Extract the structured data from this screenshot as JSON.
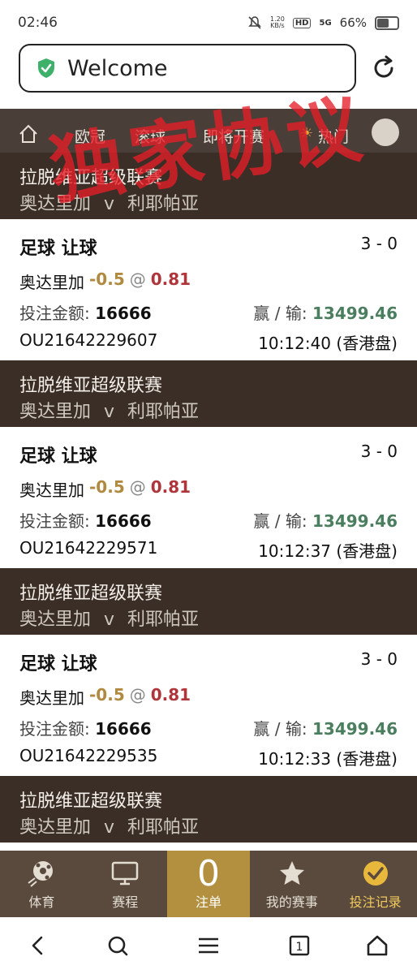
{
  "status": {
    "time": "02:46",
    "net_speed": "1.20",
    "net_unit": "KB/s",
    "hd": "HD",
    "signal": "5G",
    "battery": "66%"
  },
  "browser": {
    "title": "Welcome"
  },
  "sitenav": {
    "items": [
      "欧冠",
      "滚球",
      "即将开赛",
      "热门"
    ]
  },
  "watermark": "独家协议",
  "bets": [
    {
      "league": "拉脱维亚超级联赛",
      "home": "奥达里加",
      "vs": "v",
      "away": "利耶帕亚",
      "title": "足球 让球",
      "score": "3 - 0",
      "pick": "奥达里加",
      "handicap": "-0.5",
      "at": "@",
      "odds": "0.81",
      "stake_label": "投注金额:",
      "stake": "16666",
      "winloss_label": "赢 / 输:",
      "winloss": "13499.46",
      "id": "OU21642229607",
      "time": "10:12:40 (香港盘)"
    },
    {
      "league": "拉脱维亚超级联赛",
      "home": "奥达里加",
      "vs": "v",
      "away": "利耶帕亚",
      "title": "足球 让球",
      "score": "3 - 0",
      "pick": "奥达里加",
      "handicap": "-0.5",
      "at": "@",
      "odds": "0.81",
      "stake_label": "投注金额:",
      "stake": "16666",
      "winloss_label": "赢 / 输:",
      "winloss": "13499.46",
      "id": "OU21642229571",
      "time": "10:12:37 (香港盘)"
    },
    {
      "league": "拉脱维亚超级联赛",
      "home": "奥达里加",
      "vs": "v",
      "away": "利耶帕亚",
      "title": "足球 让球",
      "score": "3 - 0",
      "pick": "奥达里加",
      "handicap": "-0.5",
      "at": "@",
      "odds": "0.81",
      "stake_label": "投注金额:",
      "stake": "16666",
      "winloss_label": "赢 / 输:",
      "winloss": "13499.46",
      "id": "OU21642229535",
      "time": "10:12:33 (香港盘)"
    },
    {
      "league": "拉脱维亚超级联赛",
      "home": "奥达里加",
      "vs": "v",
      "away": "利耶帕亚"
    }
  ],
  "bottomnav": {
    "sports": "体育",
    "schedule": "赛程",
    "slip_count": "0",
    "slip": "注单",
    "my_matches": "我的赛事",
    "records": "投注记录"
  },
  "colors": {
    "nav_bg": "#4a3f38",
    "league_bg": "#3a2e27",
    "accent_gold": "#b2903f",
    "odds_red": "#b0343a",
    "win_green": "#4a7e5e"
  }
}
